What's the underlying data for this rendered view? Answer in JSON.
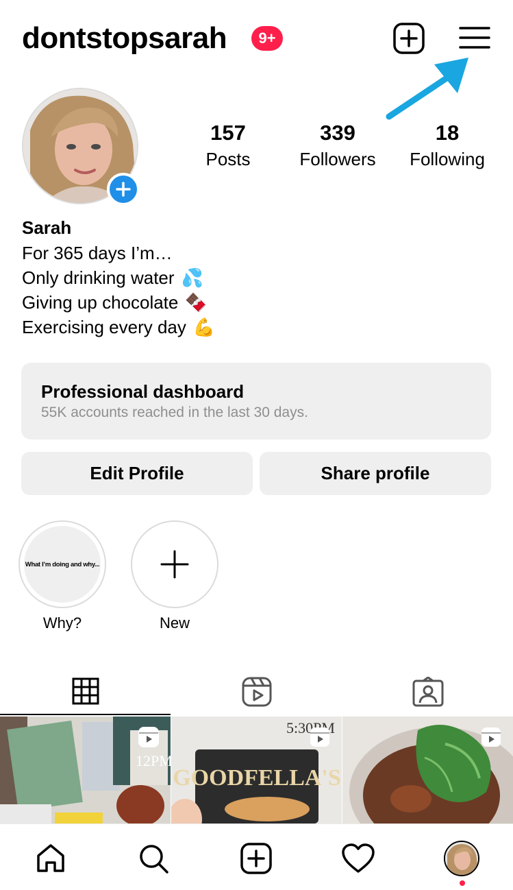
{
  "header": {
    "username": "dontstopsarah",
    "notification_badge": "9+",
    "create_icon": "plus-square-icon",
    "menu_icon": "hamburger-menu-icon",
    "annotation": "blue-arrow-pointing-to-menu"
  },
  "profile": {
    "stats": [
      {
        "value": "157",
        "label": "Posts"
      },
      {
        "value": "339",
        "label": "Followers"
      },
      {
        "value": "18",
        "label": "Following"
      }
    ],
    "name": "Sarah",
    "bio": [
      {
        "text": "For 365 days I’m…",
        "emoji": ""
      },
      {
        "text": "Only drinking water",
        "emoji": "💦"
      },
      {
        "text": "Giving up chocolate",
        "emoji": "🍫"
      },
      {
        "text": "Exercising every day",
        "emoji": "💪"
      }
    ]
  },
  "dashboard": {
    "title": "Professional dashboard",
    "subtitle": "55K accounts reached in the last 30 days."
  },
  "buttons": {
    "edit_profile": "Edit Profile",
    "share_profile": "Share profile"
  },
  "highlights": [
    {
      "label": "Why?",
      "cover_text": "What I’m doing and why..."
    },
    {
      "label": "New"
    }
  ],
  "tabs": [
    {
      "icon": "grid-icon",
      "active": true
    },
    {
      "icon": "reels-icon",
      "active": false
    },
    {
      "icon": "tagged-icon",
      "active": false
    }
  ],
  "posts": [
    {
      "overlay_text": "12PM",
      "reel_icon": "reels-icon"
    },
    {
      "overlay_text": "5:30PM",
      "title_text": "GOODFELLA'S",
      "reel_icon": "reels-icon"
    },
    {
      "reel_icon": "reels-icon"
    }
  ],
  "bottom_nav": [
    {
      "icon": "home-icon"
    },
    {
      "icon": "search-icon"
    },
    {
      "icon": "create-icon"
    },
    {
      "icon": "heart-icon"
    },
    {
      "icon": "profile-avatar"
    }
  ],
  "colors": {
    "badge": "#ff1f4b",
    "accent_blue": "#1f8fe8",
    "arrow": "#1aa6e0",
    "button_bg": "#efefef",
    "muted_text": "#8e8e8e"
  }
}
